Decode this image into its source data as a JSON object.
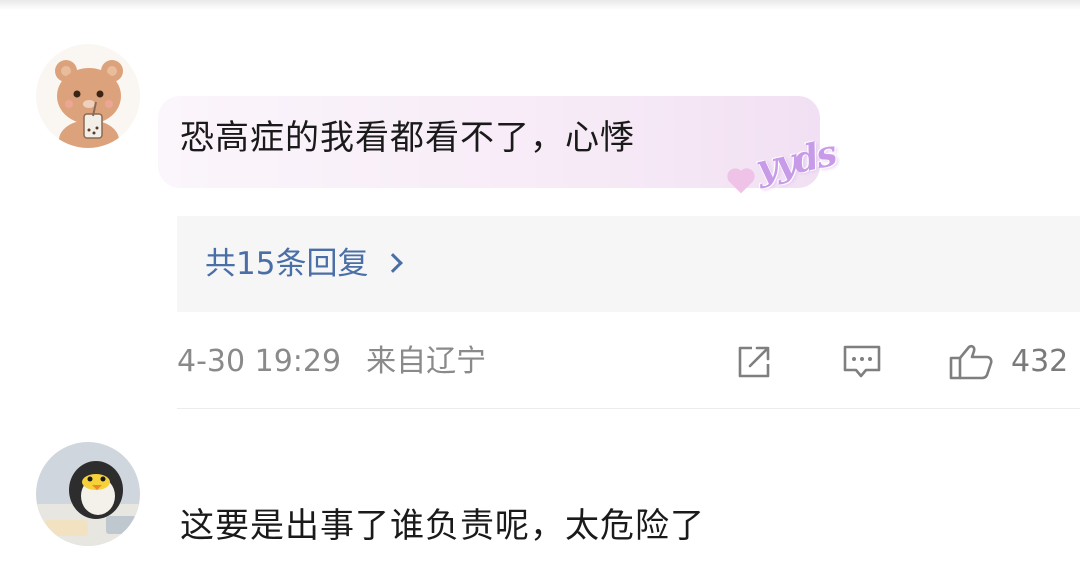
{
  "comments": [
    {
      "avatar_icon": "teddy-bear-avatar-icon",
      "text": "恐高症的我看都看不了，心悸",
      "badge": "yyds",
      "replies_label": "共15条回复",
      "timestamp": "4-30 19:29",
      "location": "来自辽宁",
      "actions": {
        "share_icon": "share-icon",
        "comment_icon": "comment-icon",
        "like_icon": "thumbs-up-icon",
        "like_count": "432"
      }
    },
    {
      "avatar_icon": "penguin-avatar-icon",
      "text": "这要是出事了谁负责呢，太危险了"
    }
  ],
  "colors": {
    "link_blue": "#4a6ea6",
    "meta_gray": "#8a8a8a",
    "badge_purple": "#c79be8",
    "reply_bg": "#f6f6f7"
  }
}
